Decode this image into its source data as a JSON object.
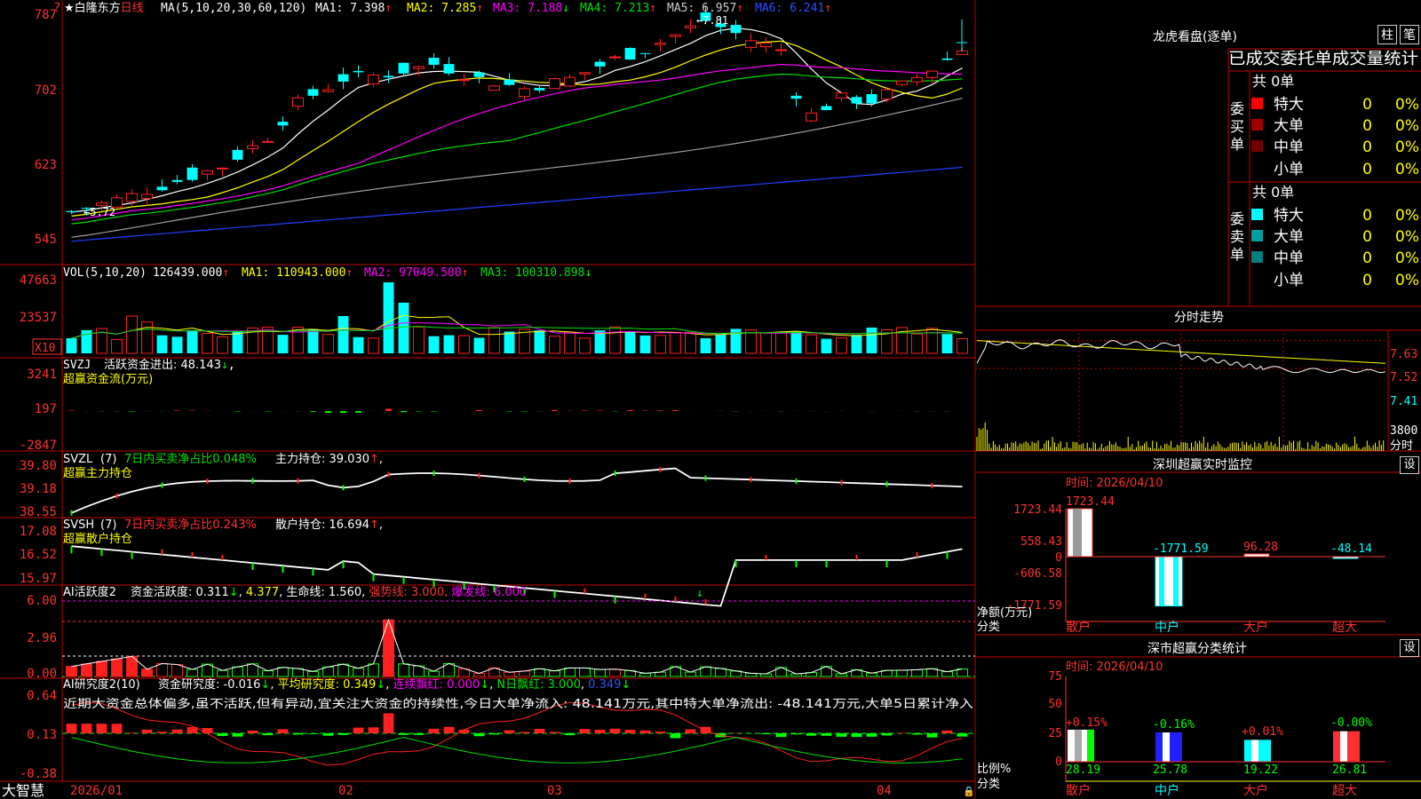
{
  "colors": {
    "up": "#ff2020",
    "down": "#00ffff",
    "ma1": "#ffffff",
    "ma2": "#ffff00",
    "ma3": "#ff00ff",
    "ma4": "#00e000",
    "ma5": "#a0a0a0",
    "ma6": "#2040ff",
    "frame": "#c00000",
    "bg": "#000000"
  },
  "main_chart": {
    "title": "白隆东方",
    "title_prefix": "★",
    "period": "日线",
    "ma_spec": "MA(5,10,20,30,60,120)",
    "ma_labels": [
      {
        "name": "MA1",
        "value": "7.398",
        "arrow": "↑"
      },
      {
        "name": "MA2",
        "value": "7.285",
        "arrow": "↑"
      },
      {
        "name": "MA3",
        "value": "7.188",
        "arrow": "↓"
      },
      {
        "name": "MA4",
        "value": "7.213",
        "arrow": "↑"
      },
      {
        "name": "MA5",
        "value": "6.957",
        "arrow": "↑"
      },
      {
        "name": "MA6",
        "value": "6.241",
        "arrow": "↑"
      }
    ],
    "y_ticks": [
      "787",
      "702",
      "623",
      "545"
    ],
    "high_marker": "7.81",
    "low_marker": "5.72",
    "low_value": 5.72,
    "high_value": 7.81
  },
  "volume_panel": {
    "spec": "VOL(5,10,20)",
    "value": "126439.000",
    "arrow": "↑",
    "ma1": "110943.000",
    "ma1_arrow": "↑",
    "ma2": "97049.500",
    "ma2_arrow": "↑",
    "ma3": "100310.898",
    "ma3_arrow": "↓",
    "y_ticks": [
      "47663",
      "23537"
    ],
    "unit": "X10"
  },
  "svzj_panel": {
    "name": "SVZJ",
    "item": "活跃资金进出: 48.143",
    "arrow": "↓",
    "subtitle": "超赢资金流(万元)",
    "y_ticks": [
      "3241",
      "197",
      "-2847"
    ]
  },
  "svzl_panel": {
    "name": "SVZL",
    "period": "(7)",
    "item1": "7日内买卖净占比0.048%",
    "item2": "主力持仓: 39.030",
    "arrow": "↑",
    "subtitle": "超赢主力持仓",
    "y_ticks": [
      "39.80",
      "39.18",
      "38.55"
    ]
  },
  "svsh_panel": {
    "name": "SVSH",
    "period": "(7)",
    "item1": "7日内买卖净占比0.243%",
    "item2": "散户持仓: 16.694",
    "arrow": "↑",
    "subtitle": "超赢散户持仓",
    "y_ticks": [
      "17.08",
      "16.52",
      "15.97"
    ]
  },
  "ai_active_panel": {
    "name": "AI活跃度2",
    "item1": "资金活跃度: 0.311",
    "arrow1": "↓",
    "item2": "4.377",
    "item3": "生命线: 1.560",
    "item4": "强势线: 3.000",
    "item5": "爆发线: 6.000",
    "y_ticks": [
      "6.00",
      "2.96",
      "0.00"
    ]
  },
  "ai_research_panel": {
    "name": "AI研究度2(10)",
    "item1": "资金研究度: -0.016",
    "arrow1": "↓",
    "item2": "平均研究度: 0.349",
    "arrow2": "↓",
    "item3": "连续飘红: 0.000",
    "arrow3": "↓",
    "item4": "N日飘红: 3.000",
    "item5": "0.349",
    "arrow5": "↓",
    "note": "近期大资金总体偏多,虽不活跃,但有异动,宜关注大资金的持续性,今日大单净流入: 48.141万元,其中特大单净流出: -48.141万元,大单5日累计净入",
    "y_ticks": [
      "0.64",
      "0.13",
      "-0.38"
    ]
  },
  "x_axis": {
    "labels": [
      "2026/01",
      "02",
      "03",
      "04"
    ]
  },
  "app_name": "大智慧",
  "right_panel": {
    "dragon_title": "龙虎看盘(逐单)",
    "btn_bar": "柱",
    "btn_stroke": "笔",
    "stats_title": "已成交委托单成交量统计",
    "buy": {
      "group_label": "委买单",
      "total": "共 0单",
      "rows": [
        {
          "name": "特大",
          "count": "0",
          "pct": "0%"
        },
        {
          "name": "大单",
          "count": "0",
          "pct": "0%"
        },
        {
          "name": "中单",
          "count": "0",
          "pct": "0%"
        },
        {
          "name": "小单",
          "count": "0",
          "pct": "0%"
        }
      ]
    },
    "sell": {
      "group_label": "委卖单",
      "total": "共 0单",
      "rows": [
        {
          "name": "特大",
          "count": "0",
          "pct": "0%"
        },
        {
          "name": "大单",
          "count": "0",
          "pct": "0%"
        },
        {
          "name": "中单",
          "count": "0",
          "pct": "0%"
        },
        {
          "name": "小单",
          "count": "0",
          "pct": "0%"
        }
      ]
    },
    "intraday": {
      "title": "分时走势",
      "price_ticks": [
        "7.63",
        "7.52",
        "7.41"
      ],
      "vol_ticks": [
        "3800",
        "分时"
      ]
    },
    "sz_monitor": {
      "title": "深圳超赢实时监控",
      "set_btn": "设",
      "time": "时间: 2026/04/10",
      "y_ticks": [
        "1723.44",
        "558.43",
        "0",
        "-606.58",
        "-1771.59"
      ],
      "y_label": "净额(万元)",
      "x_label": "分类",
      "categories": [
        "散户",
        "中户",
        "大户",
        "超大"
      ],
      "bar_labels": [
        "1723.44",
        "-1771.59",
        "96.28",
        "-48.14"
      ]
    },
    "sz_classify": {
      "title": "深市超赢分类统计",
      "set_btn": "设",
      "time": "时间: 2026/04/10",
      "y_ticks": [
        "75",
        "50",
        "25",
        "0"
      ],
      "y_label": "比例%",
      "x_label": "分类",
      "categories": [
        "散户",
        "中户",
        "大户",
        "超大"
      ],
      "bar_top_labels": [
        "+0.15%",
        "-0.16%",
        "+0.01%",
        "-0.00%"
      ],
      "bar_bottom_labels": [
        "28.19",
        "25.78",
        "19.22",
        "26.81"
      ]
    }
  },
  "chart_data": [
    {
      "type": "candlestick",
      "title": "白隆东方 日线",
      "ma_periods": [
        5,
        10,
        20,
        30,
        60,
        120
      ],
      "y_range": [
        5.45,
        7.87
      ],
      "high": 7.81,
      "low": 5.72,
      "series": [
        {
          "name": "MA1",
          "last": 7.398
        },
        {
          "name": "MA2",
          "last": 7.285
        },
        {
          "name": "MA3",
          "last": 7.188
        },
        {
          "name": "MA4",
          "last": 7.213
        },
        {
          "name": "MA5",
          "last": 6.957
        },
        {
          "name": "MA6",
          "last": 6.241
        }
      ]
    },
    {
      "type": "bar",
      "title": "VOL(5,10,20)",
      "last_value": 126439.0,
      "ma": [
        110943.0,
        97049.5,
        100310.898
      ],
      "y_max": 47663
    },
    {
      "type": "bar",
      "title": "SVZJ 活跃资金进出",
      "last_value": 48.143,
      "y_range": [
        -2847,
        3241
      ]
    },
    {
      "type": "line",
      "title": "SVZL 主力持仓",
      "last_value": 39.03,
      "y_range": [
        38.55,
        39.8
      ]
    },
    {
      "type": "line",
      "title": "SVSH 散户持仓",
      "last_value": 16.694,
      "y_range": [
        15.97,
        17.08
      ]
    },
    {
      "type": "bar",
      "title": "AI活跃度2",
      "last_value": 0.311,
      "lines": {
        "生命线": 1.56,
        "强势线": 3.0,
        "爆发线": 6.0
      },
      "y_range": [
        0,
        6
      ]
    },
    {
      "type": "bar",
      "title": "AI研究度2(10)",
      "last_value": -0.016,
      "avg": 0.349,
      "y_range": [
        -0.38,
        0.64
      ]
    },
    {
      "type": "line",
      "title": "分时走势",
      "y_ticks": [
        7.63,
        7.52,
        7.41
      ]
    },
    {
      "type": "bar",
      "title": "深圳超赢实时监控",
      "categories": [
        "散户",
        "中户",
        "大户",
        "超大"
      ],
      "values": [
        1723.44,
        -1771.59,
        96.28,
        -48.14
      ],
      "ylabel": "净额(万元)",
      "y_range": [
        -1771.59,
        1723.44
      ]
    },
    {
      "type": "bar",
      "title": "深市超赢分类统计",
      "categories": [
        "散户",
        "中户",
        "大户",
        "超大"
      ],
      "values": [
        28.19,
        25.78,
        19.22,
        26.81
      ],
      "changes": [
        "+0.15%",
        "-0.16%",
        "+0.01%",
        "-0.00%"
      ],
      "ylabel": "比例%",
      "y_range": [
        0,
        75
      ]
    }
  ]
}
